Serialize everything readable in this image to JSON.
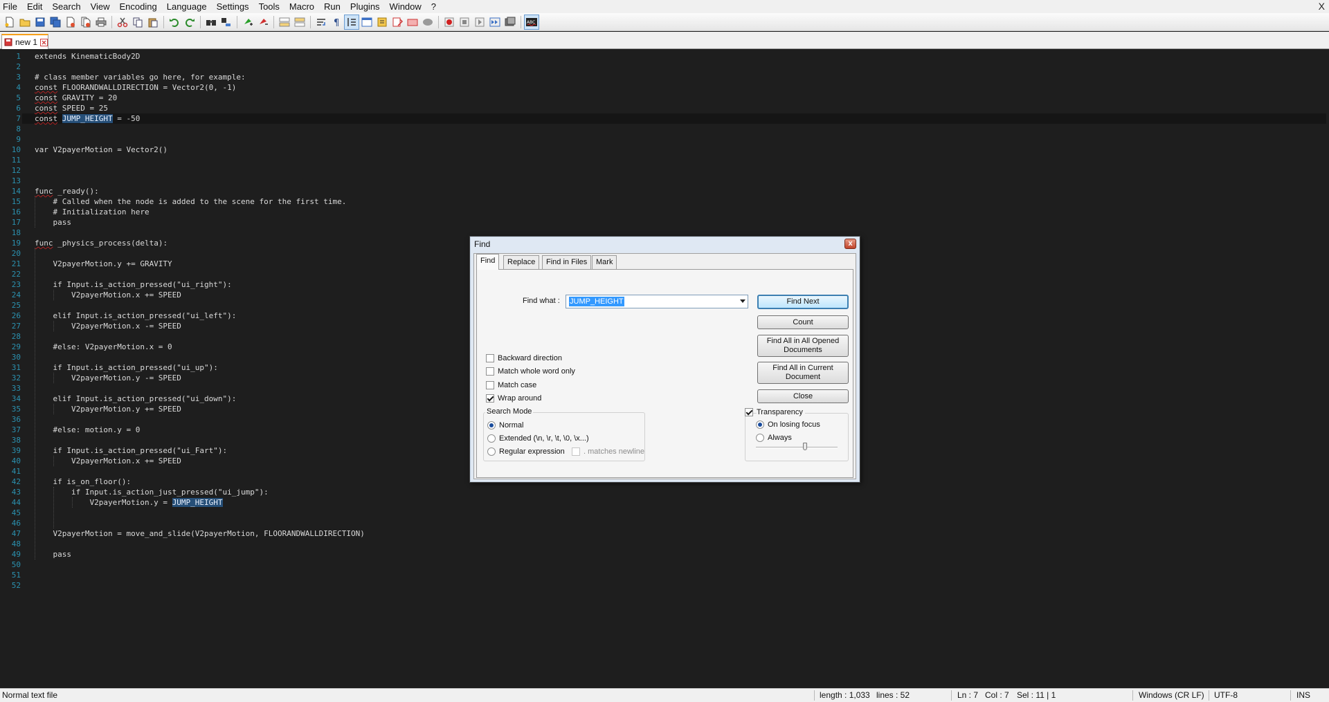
{
  "menubar": {
    "items": [
      "File",
      "Edit",
      "Search",
      "View",
      "Encoding",
      "Language",
      "Settings",
      "Tools",
      "Macro",
      "Run",
      "Plugins",
      "Window",
      "?"
    ],
    "close_glyph": "X"
  },
  "toolbar": {
    "buttons": [
      "new-file-icon",
      "open-file-icon",
      "save-icon",
      "save-all-icon",
      "close-icon",
      "close-all-icon",
      "print-icon",
      "cut-icon",
      "copy-icon",
      "paste-icon",
      "undo-icon",
      "redo-icon",
      "find-icon",
      "replace-icon",
      "zoom-in-icon",
      "zoom-out-icon",
      "sync-vertical-icon",
      "sync-horizontal-icon",
      "word-wrap-icon",
      "show-all-chars-icon",
      "indent-guide-icon",
      "function-list-icon",
      "folder-workspace-icon",
      "doc-map-icon",
      "monitoring-icon",
      "record-macro-icon",
      "stop-macro-icon",
      "play-macro-icon",
      "run-macro-multiple-icon",
      "save-macro-icon",
      "spell-check-icon"
    ]
  },
  "tab": {
    "label": "new 1"
  },
  "editor": {
    "lines": [
      "extends KinematicBody2D",
      "",
      "# class member variables go here, for example:",
      "const FLOORANDWALLDIRECTION = Vector2(0, -1)",
      "const GRAVITY = 20",
      "const SPEED = 25",
      "const JUMP_HEIGHT = -50",
      "",
      "",
      "var V2payerMotion = Vector2()",
      "",
      "",
      "",
      "func _ready():",
      "    # Called when the node is added to the scene for the first time.",
      "    # Initialization here",
      "    pass",
      "",
      "func _physics_process(delta):",
      "",
      "    V2payerMotion.y += GRAVITY",
      "",
      "    if Input.is_action_pressed(\"ui_right\"):",
      "        V2payerMotion.x += SPEED",
      "",
      "    elif Input.is_action_pressed(\"ui_left\"):",
      "        V2payerMotion.x -= SPEED",
      "",
      "    #else: V2payerMotion.x = 0",
      "",
      "    if Input.is_action_pressed(\"ui_up\"):",
      "        V2payerMotion.y -= SPEED",
      "",
      "    elif Input.is_action_pressed(\"ui_down\"):",
      "        V2payerMotion.y += SPEED",
      "",
      "    #else: motion.y = 0",
      "",
      "    if Input.is_action_pressed(\"ui_Fart\"):",
      "        V2payerMotion.x += SPEED",
      "",
      "    if is_on_floor():",
      "        if Input.is_action_just_pressed(\"ui_jump\"):",
      "            V2payerMotion.y = JUMP_HEIGHT",
      "",
      "",
      "    V2payerMotion = move_and_slide(V2payerMotion, FLOORANDWALLDIRECTION)",
      "",
      "    pass",
      "",
      "",
      ""
    ],
    "current_line": 7,
    "highlight_word": "JUMP_HEIGHT"
  },
  "find_dialog": {
    "title": "Find",
    "close_glyph": "x",
    "tabs": [
      "Find",
      "Replace",
      "Find in Files",
      "Mark"
    ],
    "active_tab": "Find",
    "find_what_label": "Find what :",
    "find_what_value": "JUMP_HEIGHT",
    "buttons": {
      "find_next": "Find Next",
      "count": "Count",
      "find_all_opened": "Find All in All Opened Documents",
      "find_all_current": "Find All in Current Document",
      "close": "Close"
    },
    "options": {
      "backward": {
        "label": "Backward direction",
        "checked": false
      },
      "whole_word": {
        "label": "Match whole word only",
        "checked": false
      },
      "match_case": {
        "label": "Match case",
        "checked": false
      },
      "wrap_around": {
        "label": "Wrap around",
        "checked": true
      }
    },
    "search_mode": {
      "title": "Search Mode",
      "normal": "Normal",
      "extended": "Extended (\\n, \\r, \\t, \\0, \\x...)",
      "regex": "Regular expression",
      "matches_newline": ". matches newline",
      "selected": "Normal"
    },
    "transparency": {
      "label": "Transparency",
      "checked": true,
      "on_losing_focus": "On losing focus",
      "always": "Always",
      "selected": "On losing focus",
      "level": 0.6
    }
  },
  "statusbar": {
    "file_type": "Normal text file",
    "length": "length : 1,033",
    "lines": "lines : 52",
    "ln": "Ln : 7",
    "col": "Col : 7",
    "sel": "Sel : 11 | 1",
    "eol": "Windows (CR LF)",
    "encoding": "UTF-8",
    "ins": "INS"
  }
}
